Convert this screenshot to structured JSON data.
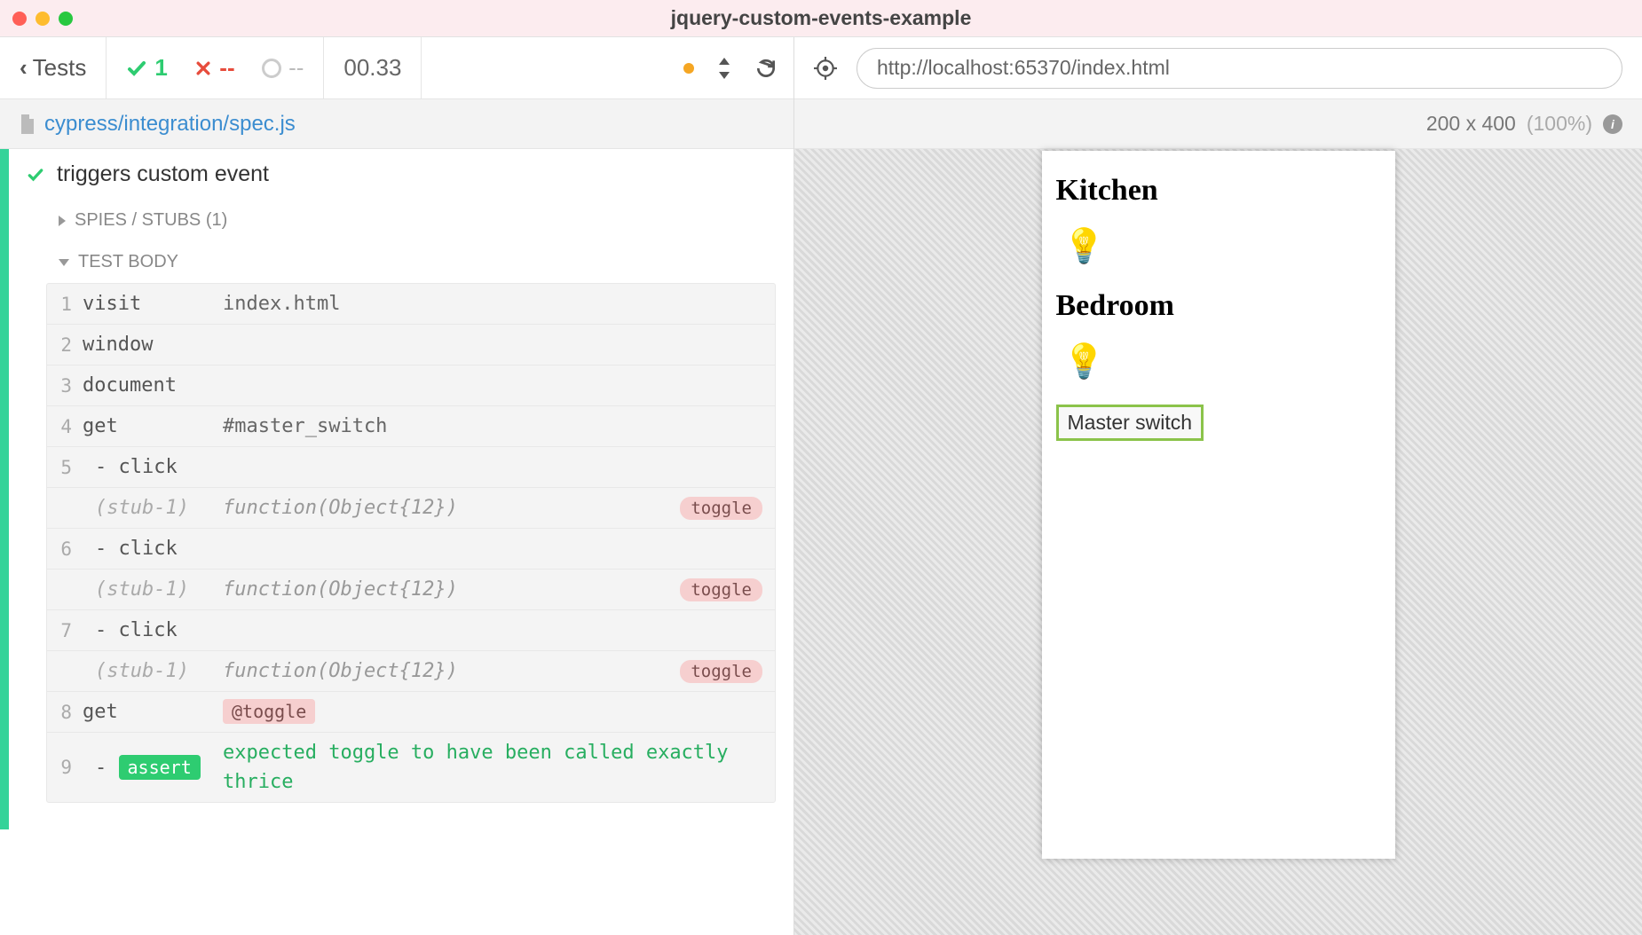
{
  "window": {
    "title": "jquery-custom-events-example"
  },
  "toolbar": {
    "back_label": "Tests",
    "pass_count": "1",
    "fail_count": "--",
    "pending_count": "--",
    "duration": "00.33"
  },
  "spec": {
    "file": "cypress/integration/spec.js"
  },
  "test": {
    "title": "triggers custom event",
    "spies_label": "SPIES / STUBS (1)",
    "body_label": "TEST BODY"
  },
  "commands": [
    {
      "num": "1",
      "name": "visit",
      "msg": "index.html",
      "type": "plain"
    },
    {
      "num": "2",
      "name": "window",
      "msg": "",
      "type": "plain"
    },
    {
      "num": "3",
      "name": "document",
      "msg": "",
      "type": "plain"
    },
    {
      "num": "4",
      "name": "get",
      "msg": "#master_switch",
      "type": "plain"
    },
    {
      "num": "5",
      "name": "- click",
      "msg": "",
      "type": "child"
    },
    {
      "num": "",
      "name": "(stub-1)",
      "msg": "function(Object{12})",
      "type": "stub",
      "badge": "toggle"
    },
    {
      "num": "6",
      "name": "- click",
      "msg": "",
      "type": "child"
    },
    {
      "num": "",
      "name": "(stub-1)",
      "msg": "function(Object{12})",
      "type": "stub",
      "badge": "toggle"
    },
    {
      "num": "7",
      "name": "- click",
      "msg": "",
      "type": "child"
    },
    {
      "num": "",
      "name": "(stub-1)",
      "msg": "function(Object{12})",
      "type": "stub",
      "badge": "toggle"
    },
    {
      "num": "8",
      "name": "get",
      "msg": "@toggle",
      "type": "alias"
    },
    {
      "num": "9",
      "name": "assert",
      "msg": "expected toggle to have been called exactly thrice",
      "type": "assert"
    }
  ],
  "url": "http://localhost:65370/index.html",
  "viewport": {
    "size": "200 x 400",
    "zoom": "(100%)"
  },
  "aut": {
    "room1": "Kitchen",
    "room2": "Bedroom",
    "button": "Master switch"
  }
}
